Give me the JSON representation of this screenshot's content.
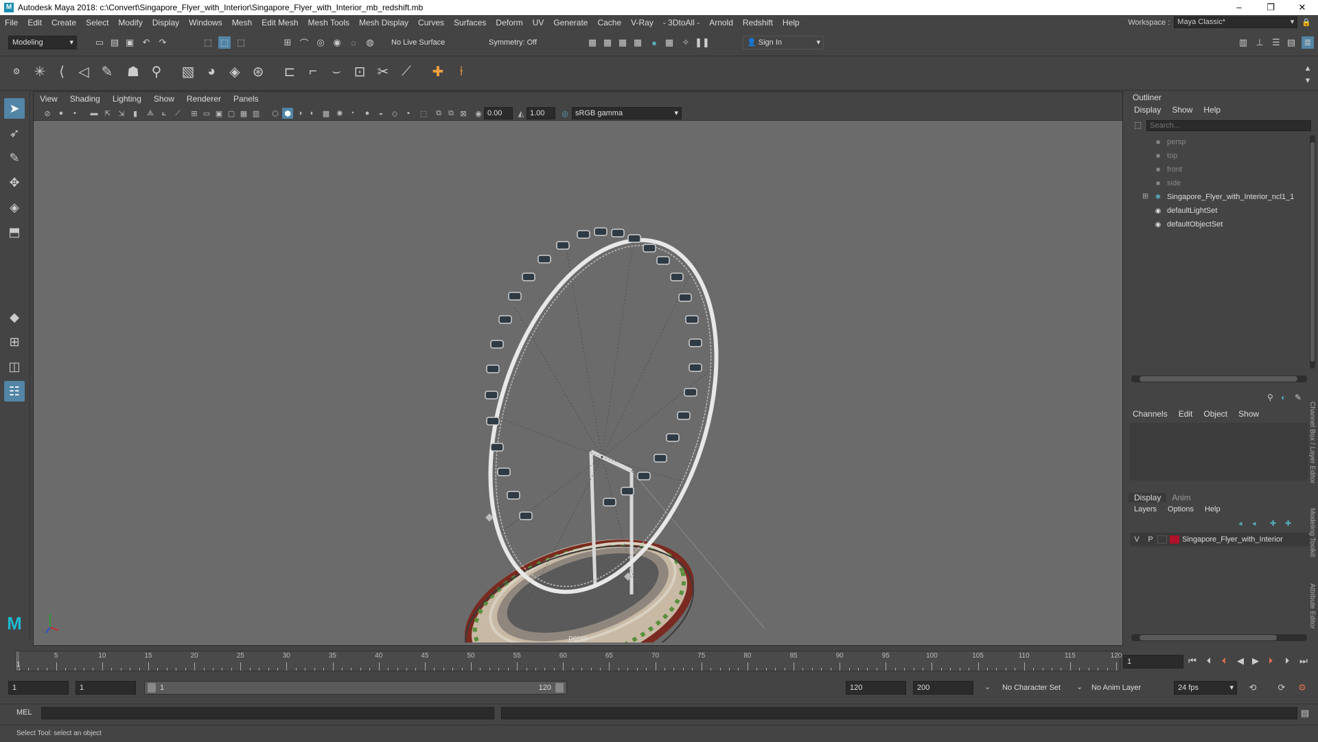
{
  "window": {
    "title": "Autodesk Maya 2018: c:\\Convert\\Singapore_Flyer_with_Interior\\Singapore_Flyer_with_Interior_mb_redshift.mb",
    "logo": "M",
    "minimize": "–",
    "restore": "❐",
    "close": "✕"
  },
  "menubar": {
    "items": [
      "File",
      "Edit",
      "Create",
      "Select",
      "Modify",
      "Display",
      "Windows",
      "Mesh",
      "Edit Mesh",
      "Mesh Tools",
      "Mesh Display",
      "Curves",
      "Surfaces",
      "Deform",
      "UV",
      "Generate",
      "Cache",
      "V-Ray",
      "- 3DtoAll -",
      "Arnold",
      "Redshift",
      "Help"
    ],
    "workspace_label": "Workspace :",
    "workspace_value": "Maya Classic*"
  },
  "statusline": {
    "menuset": "Modeling",
    "live_surface": "No Live Surface",
    "symmetry": "Symmetry: Off",
    "sign_in": "Sign In"
  },
  "viewport": {
    "menu": [
      "View",
      "Shading",
      "Lighting",
      "Show",
      "Renderer",
      "Panels"
    ],
    "exposure": "0.00",
    "gamma": "1.00",
    "color_space": "sRGB gamma",
    "camera": "persp"
  },
  "outliner": {
    "title": "Outliner",
    "menu": [
      "Display",
      "Show",
      "Help"
    ],
    "search_placeholder": "Search...",
    "items": [
      {
        "label": "persp",
        "dim": true
      },
      {
        "label": "top",
        "dim": true
      },
      {
        "label": "front",
        "dim": true
      },
      {
        "label": "side",
        "dim": true
      },
      {
        "label": "Singapore_Flyer_with_Interior_ncl1_1",
        "dim": false
      },
      {
        "label": "defaultLightSet",
        "dim": false
      },
      {
        "label": "defaultObjectSet",
        "dim": false
      }
    ],
    "expand": "⊞"
  },
  "channelbox": {
    "menu": [
      "Channels",
      "Edit",
      "Object",
      "Show"
    ],
    "tabs": [
      "Display",
      "Anim"
    ],
    "layer_menu": [
      "Layers",
      "Options",
      "Help"
    ],
    "layer": {
      "v": "V",
      "p": "P",
      "name": "Singapore_Flyer_with_Interior",
      "color": "#b0102a"
    },
    "side_tabs": [
      "Channel Box / Layer Editor",
      "Modeling Toolkit",
      "Attribute Editor"
    ]
  },
  "timeslider": {
    "labels": [
      5,
      10,
      15,
      20,
      25,
      30,
      35,
      40,
      45,
      50,
      55,
      60,
      65,
      70,
      75,
      80,
      85,
      90,
      95,
      100,
      105,
      110,
      115,
      120
    ],
    "current_frame_marker": "1",
    "current_frame": "1"
  },
  "range": {
    "start": "1",
    "anim_start": "1",
    "range_start": "1",
    "range_end": "120",
    "anim_end": "120",
    "end": "200",
    "character_set": "No Character Set",
    "anim_layer": "No Anim Layer",
    "fps": "24 fps"
  },
  "cmdline": {
    "label": "MEL"
  },
  "helpline": {
    "text": "Select Tool: select an object"
  }
}
